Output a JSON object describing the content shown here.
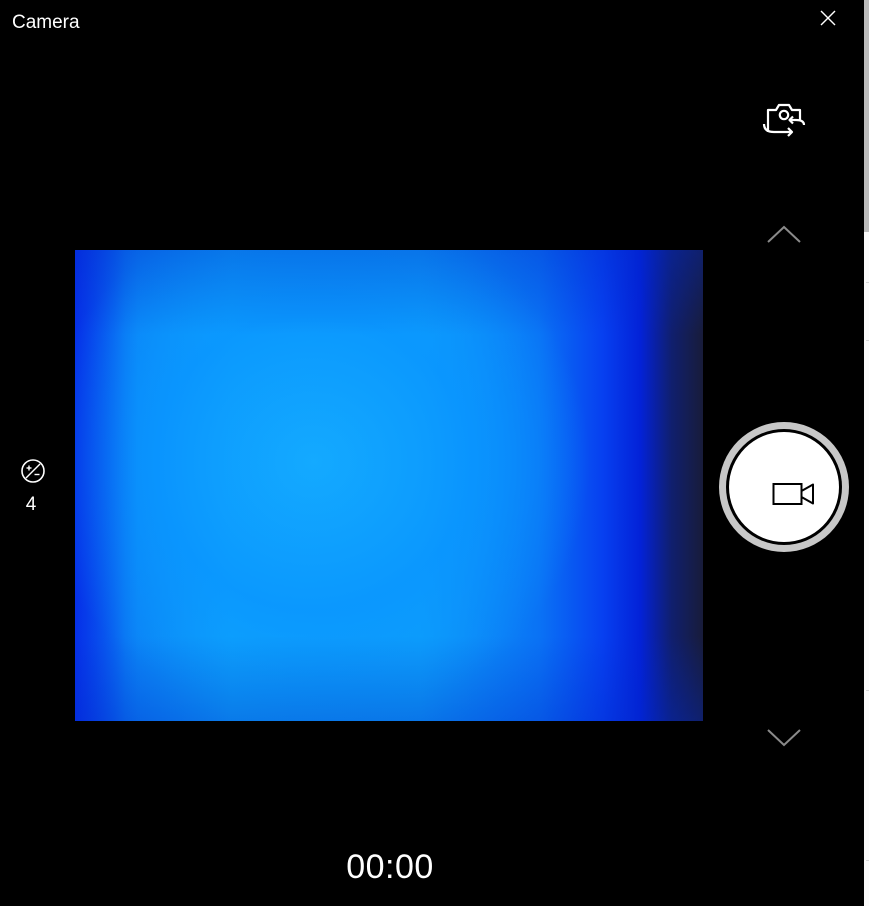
{
  "window": {
    "title": "Camera",
    "close_icon": "close-icon"
  },
  "controls": {
    "switch_camera_icon": "camera-switch-icon",
    "mode_up_icon": "chevron-up-icon",
    "mode_down_icon": "chevron-down-icon",
    "record_icon": "video-camera-icon"
  },
  "exposure": {
    "icon": "exposure-compensation-icon",
    "value": "4"
  },
  "recording": {
    "timer": "00:00"
  },
  "colors": {
    "background": "#000000",
    "foreground": "#ffffff",
    "viewfinder_blue": "#0ea6fb",
    "record_ring": "#c8c8c8"
  }
}
